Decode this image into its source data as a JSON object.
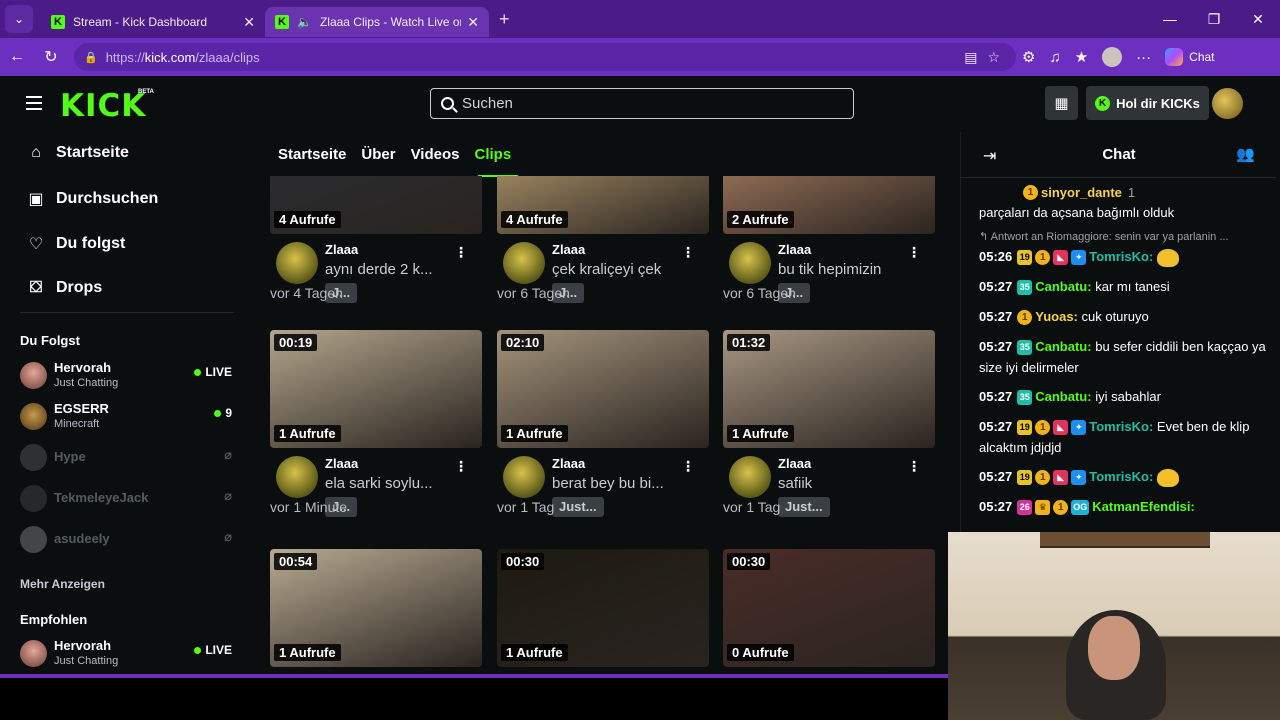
{
  "browser": {
    "tabs": [
      {
        "title": "Stream - Kick Dashboard",
        "active": false
      },
      {
        "title": "Zlaaa Clips - Watch Live on Kick",
        "active": true
      }
    ],
    "url_prefix": "https://",
    "url_domain": "kick.com",
    "url_path": "/zlaaa/clips",
    "copilot_label": "Chat"
  },
  "header": {
    "logo": "KICK",
    "beta": "BETA",
    "search_placeholder": "Suchen",
    "kicks_button": "Hol dir KICKs"
  },
  "sidebar": {
    "nav": [
      {
        "label": "Startseite",
        "icon": "home-icon"
      },
      {
        "label": "Durchsuchen",
        "icon": "browse-icon"
      },
      {
        "label": "Du folgst",
        "icon": "heart-icon"
      },
      {
        "label": "Drops",
        "icon": "drops-icon"
      }
    ],
    "following_title": "Du Folgst",
    "following": [
      {
        "name": "Hervorah",
        "category": "Just Chatting",
        "status": "LIVE",
        "live": true
      },
      {
        "name": "EGSERR",
        "category": "Minecraft",
        "status": "9",
        "live": true
      },
      {
        "name": "Hype",
        "category": "",
        "status": "offline",
        "live": false
      },
      {
        "name": "TekmeleyeJack",
        "category": "",
        "status": "offline",
        "live": false
      },
      {
        "name": "asudeely",
        "category": "",
        "status": "offline",
        "live": false
      }
    ],
    "more_label": "Mehr Anzeigen",
    "recommended_title": "Empfohlen",
    "recommended": [
      {
        "name": "Hervorah",
        "category": "Just Chatting",
        "status": "LIVE"
      }
    ]
  },
  "profile_tabs": [
    "Startseite",
    "Über",
    "Videos",
    "Clips"
  ],
  "active_tab": "Clips",
  "clips": [
    {
      "duration": "",
      "views": "4 Aufrufe",
      "channel": "Zlaaa",
      "title": "aynı derde 2 k...",
      "category": "J...",
      "time": "vor 4 Tagen",
      "thumb": "#2b2f36"
    },
    {
      "duration": "",
      "views": "4 Aufrufe",
      "channel": "Zlaaa",
      "title": "çek kraliçeyi çek",
      "category": "J...",
      "time": "vor 6 Tagen",
      "thumb": "#c9ac7a"
    },
    {
      "duration": "",
      "views": "2 Aufrufe",
      "channel": "Zlaaa",
      "title": "bu tik hepimizin",
      "category": "J...",
      "time": "vor 6 Tagen",
      "thumb": "#b98a6b"
    },
    {
      "duration": "00:19",
      "views": "1 Aufrufe",
      "channel": "Zlaaa",
      "title": "ela sarki soylu...",
      "category": "J...",
      "time": "vor 1 Minute",
      "thumb": "#b3a58c"
    },
    {
      "duration": "02:10",
      "views": "1 Aufrufe",
      "channel": "Zlaaa",
      "title": "berat bey bu bi...",
      "category": "Just...",
      "time": "vor 1 Tag",
      "thumb": "#a3937b"
    },
    {
      "duration": "01:32",
      "views": "1 Aufrufe",
      "channel": "Zlaaa",
      "title": "safiik",
      "category": "Just...",
      "time": "vor 1 Tag",
      "thumb": "#a89783"
    },
    {
      "duration": "00:54",
      "views": "1 Aufrufe",
      "channel": "",
      "title": "",
      "category": "",
      "time": "",
      "thumb": "#b8aa92"
    },
    {
      "duration": "00:30",
      "views": "1 Aufrufe",
      "channel": "",
      "title": "",
      "category": "",
      "time": "",
      "thumb": "#1d1a12"
    },
    {
      "duration": "00:30",
      "views": "0 Aufrufe",
      "channel": "",
      "title": "",
      "category": "",
      "time": "",
      "thumb": "#4a2c28"
    }
  ],
  "chat": {
    "title": "Chat",
    "pinned_user": "sinyor_dante",
    "pinned_count": "1",
    "partial_top": "parçaları da açsana bağımlı olduk",
    "reply_to": "Antwort an Riomaggiore: senin var ya parlanin ...",
    "messages": [
      {
        "time": "05:26",
        "user": "TomrisKo:",
        "text": "",
        "color": "#1fbfa6",
        "badges": "sub19,coin,red,blue",
        "emote": true
      },
      {
        "time": "05:27",
        "user": "Canbatu:",
        "text": "kar mı tanesi",
        "color": "#53fc18",
        "badges": "sub35"
      },
      {
        "time": "05:27",
        "user": "Yuoas:",
        "text": "cuk oturuyo",
        "color": "#f7d24c",
        "badges": "coin"
      },
      {
        "time": "05:27",
        "user": "Canbatu:",
        "text": "bu sefer ciddili ben kaççao ya size iyi delirmeler",
        "color": "#53fc18",
        "badges": "sub35"
      },
      {
        "time": "05:27",
        "user": "Canbatu:",
        "text": "iyi sabahlar",
        "color": "#53fc18",
        "badges": "sub35"
      },
      {
        "time": "05:27",
        "user": "TomrisKo:",
        "text": "Evet ben de klip alcaktım jdjdjd",
        "color": "#1fbfa6",
        "badges": "sub19,coin,red,blue"
      },
      {
        "time": "05:27",
        "user": "TomrisKo:",
        "text": "",
        "color": "#1fbfa6",
        "badges": "sub19,coin,red,blue",
        "emote": true
      },
      {
        "time": "05:27",
        "user": "KatmanEfendisi:",
        "text": "",
        "color": "#53fc18",
        "badges": "sub26,crown,coin,og"
      }
    ]
  }
}
